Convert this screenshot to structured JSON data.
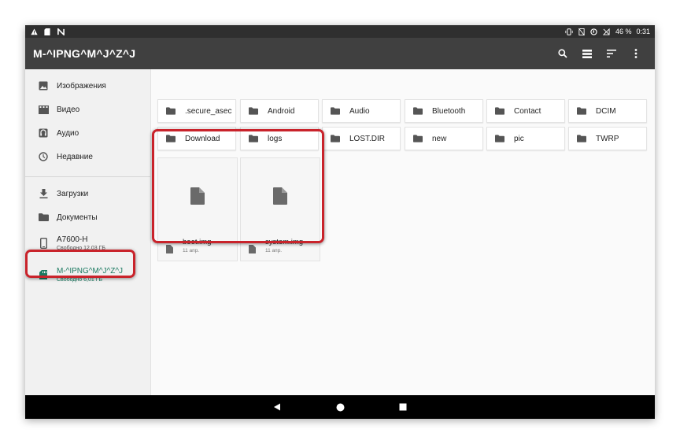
{
  "status_bar": {
    "battery_percent": "46 %",
    "time": "0:31"
  },
  "toolbar": {
    "title": "M-^IPNG^M^J^Z^J"
  },
  "sidebar": {
    "items": [
      {
        "label": "Изображения",
        "icon": "image-icon"
      },
      {
        "label": "Видео",
        "icon": "video-icon"
      },
      {
        "label": "Аудио",
        "icon": "audio-icon"
      },
      {
        "label": "Недавние",
        "icon": "clock-icon"
      },
      {
        "label": "Загрузки",
        "icon": "download-icon"
      },
      {
        "label": "Документы",
        "icon": "folder-icon"
      },
      {
        "label": "A7600-H",
        "sub": "Свободно 12,03 ГБ",
        "icon": "phone-icon"
      },
      {
        "label": "M-^IPNG^M^J^Z^J",
        "sub": "Свободно 6,01 ГБ",
        "icon": "sd-card-icon"
      }
    ]
  },
  "folders": [
    ".secure_asec",
    "Android",
    "Audio",
    "Bluetooth",
    "Contact",
    "DCIM",
    "Download",
    "logs",
    "LOST.DIR",
    "new",
    "pic",
    "TWRP"
  ],
  "files": [
    {
      "name": "boot.img",
      "date": "11 апр."
    },
    {
      "name": "system.img",
      "date": "11 апр."
    }
  ],
  "colors": {
    "toolbar": "#404040",
    "statusbar": "#2f2f2f",
    "accent": "#1b7a61",
    "highlight": "#c9232b"
  }
}
